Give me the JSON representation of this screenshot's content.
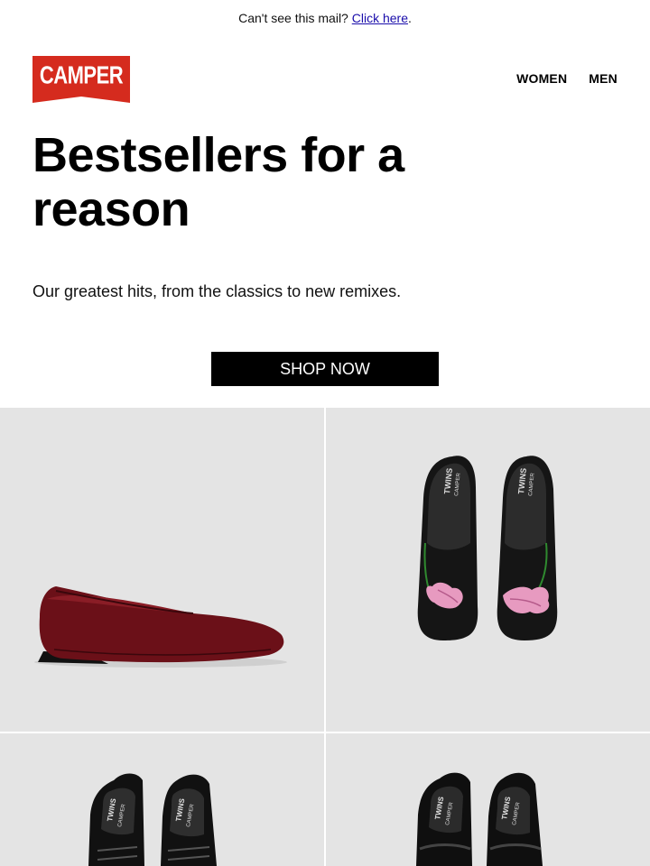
{
  "preheader": {
    "text": "Can't see this mail?",
    "link_label": "Click here",
    "suffix": "."
  },
  "brand": {
    "logo_text": "CAMPER",
    "logo_color": "#d52b1e"
  },
  "nav": {
    "items": [
      {
        "label": "WOMEN"
      },
      {
        "label": "MEN"
      }
    ]
  },
  "hero": {
    "headline": "Bestsellers for a reason",
    "subhead": "Our greatest hits, from the classics to new remixes.",
    "cta_label": "SHOP NOW"
  },
  "products": {
    "insole_label_top": "TWINS",
    "insole_label_bottom": "CAMPER",
    "tile_bg": "#e4e4e4",
    "shoe_burgundy": "#6b1018",
    "shoe_black": "#151515",
    "flower_pink": "#e79ac0"
  }
}
